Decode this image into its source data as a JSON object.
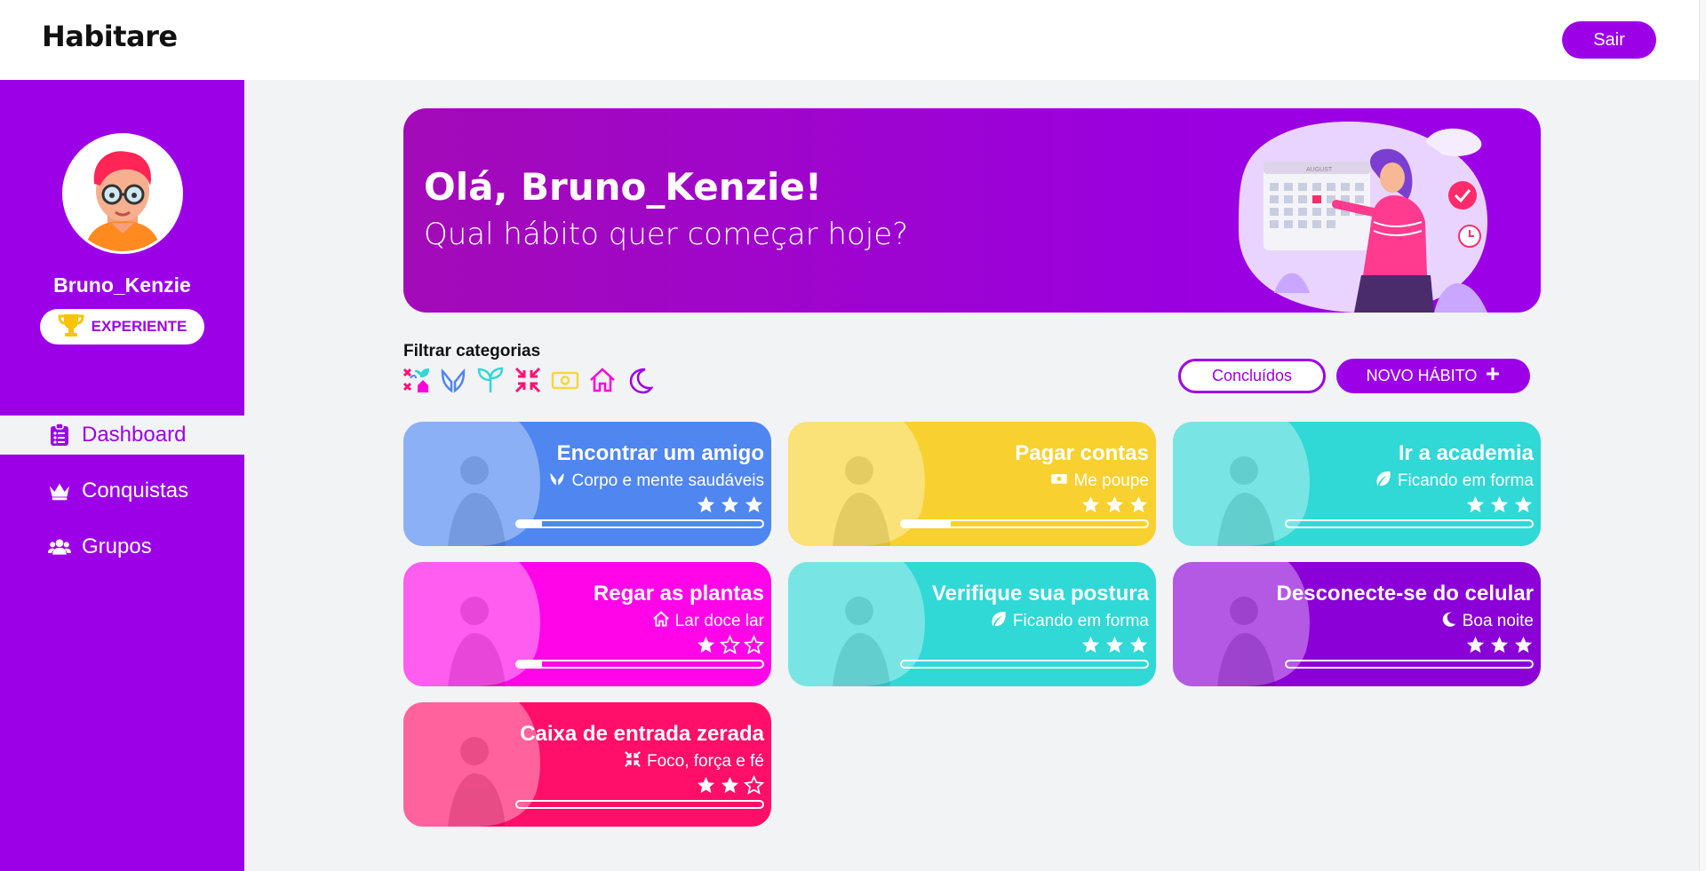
{
  "app": {
    "title": "Habitare",
    "logout_label": "Sair"
  },
  "colors": {
    "primary": "#9c00e6",
    "background": "#f2f3f5"
  },
  "profile": {
    "username": "Bruno_Kenzie",
    "level": "EXPERIENTE",
    "level_icon": "trophy-icon"
  },
  "nav": [
    {
      "label": "Dashboard",
      "icon": "clipboard-icon",
      "active": true
    },
    {
      "label": "Conquistas",
      "icon": "crown-icon",
      "active": false
    },
    {
      "label": "Grupos",
      "icon": "users-icon",
      "active": false
    }
  ],
  "banner": {
    "greeting": "Olá, Bruno_Kenzie!",
    "subtitle": "Qual hábito quer começar hoje?",
    "calendar_month": "AUGUST"
  },
  "filters": {
    "label": "Filtrar categorias",
    "categories": [
      {
        "icon": "all-categories-icon",
        "color": "#9c00e6"
      },
      {
        "icon": "hands-icon",
        "color": "#4f86f0"
      },
      {
        "icon": "sprout-icon",
        "color": "#34d6d6"
      },
      {
        "icon": "compress-icon",
        "color": "#ff1177"
      },
      {
        "icon": "money-icon",
        "color": "#f8d63a"
      },
      {
        "icon": "home-icon",
        "color": "#ff00dd"
      },
      {
        "icon": "moon-icon",
        "color": "#9c00e6"
      }
    ]
  },
  "actions": {
    "completed_label": "Concluídos",
    "new_habit_label": "NOVO HÁBITO"
  },
  "habits": [
    {
      "title": "Encontrar um amigo",
      "category": "Corpo e mente saudáveis",
      "category_icon": "hands-icon",
      "color": "#4f86f0",
      "stars": 3,
      "progress": 0.1
    },
    {
      "title": "Pagar contas",
      "category": "Me poupe",
      "category_icon": "money-icon",
      "color": "#f8d130",
      "stars": 3,
      "progress": 0.2
    },
    {
      "title": "Ir a academia",
      "category": "Ficando em forma",
      "category_icon": "leaf-icon",
      "color": "#30d8d6",
      "stars": 3,
      "progress": 0.0
    },
    {
      "title": "Regar as plantas",
      "category": "Lar doce lar",
      "category_icon": "home-icon",
      "color": "#ff05e8",
      "stars": 1,
      "progress": 0.1
    },
    {
      "title": "Verifique sua postura",
      "category": "Ficando em forma",
      "category_icon": "leaf-icon",
      "color": "#30d8d6",
      "stars": 3,
      "progress": 0.0
    },
    {
      "title": "Desconecte-se do celular",
      "category": "Boa noite",
      "category_icon": "moon-icon",
      "color": "#8a00d6",
      "stars": 3,
      "progress": 0.0
    },
    {
      "title": "Caixa de entrada zerada",
      "category": "Foco, força e fé",
      "category_icon": "compress-icon",
      "color": "#ff0f68",
      "stars": 2,
      "progress": 0.0
    }
  ]
}
